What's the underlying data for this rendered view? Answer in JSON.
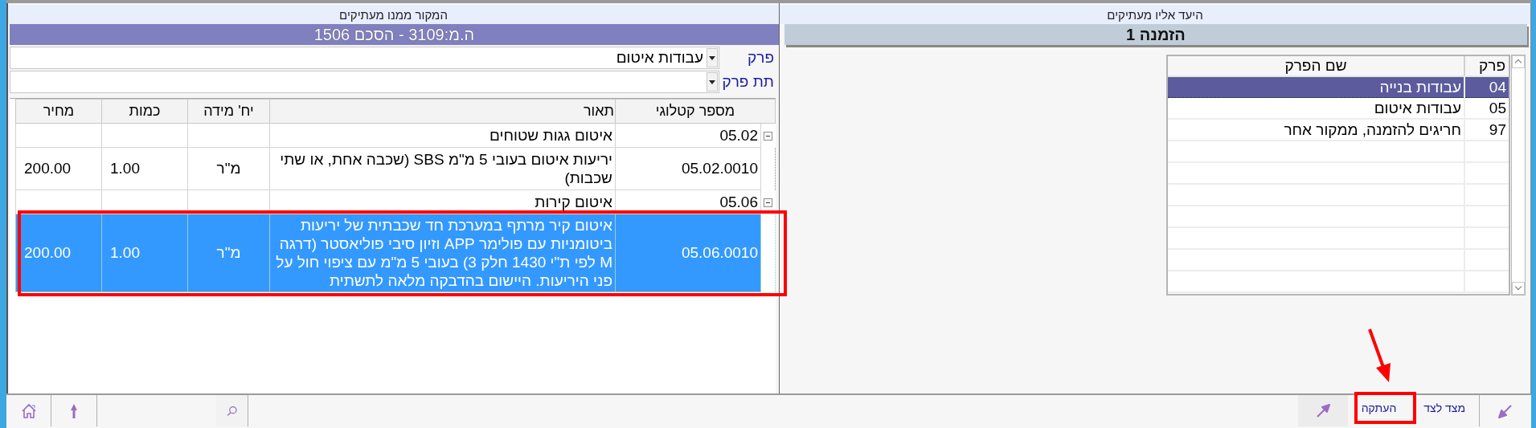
{
  "target_panel": {
    "caption": "היעד אליו מעתיקים",
    "title": "הזמנה 1",
    "list": {
      "columns": [
        "פרק",
        "שם הפרק"
      ],
      "rows": [
        {
          "number": "04",
          "name": "עבודות בנייה",
          "selected": true
        },
        {
          "number": "05",
          "name": "עבודות איטום",
          "selected": false
        },
        {
          "number": "97",
          "name": "חריגים להזמנה, ממקור אחר",
          "selected": false
        }
      ]
    }
  },
  "source_panel": {
    "caption": "המקור ממנו מעתיקים",
    "title": "ה.מ:3109 - הסכם 1506",
    "filters": [
      {
        "label": "פרק",
        "value": "עבודות איטום"
      },
      {
        "label": "תת פרק"
      }
    ],
    "table": {
      "columns": [
        "מספר קטלוגי",
        "תאור",
        "יח' מידה",
        "כמות",
        "מחיר"
      ],
      "rows": [
        {
          "kind": "group",
          "catalog": "05.02",
          "description": "איטום גגות שטוחים",
          "expanded": true,
          "children": [
            {
              "kind": "item",
              "catalog": "05.02.0010",
              "description": "יריעות איטום בעובי 5 מ\"מ SBS (שכבה אחת, או שתי שכבות)",
              "unit": "מ\"ר",
              "quantity": "1.00",
              "price": "200.00",
              "selected": false
            }
          ]
        },
        {
          "kind": "group",
          "catalog": "05.06",
          "description": "איטום קירות",
          "expanded": true,
          "children": [
            {
              "kind": "item",
              "catalog": "05.06.0010",
              "description": "איטום קיר מרתף במערכת חד שכבתית של יריעות ביטומניות עם פולימר APP וזיון סיבי פוליאסטר (דרגה M לפי ת\"י 1430 חלק 3) בעובי 5 מ\"מ עם ציפוי חול על פני היריעות. היישום בהדבקה מלאה לתשתית",
              "unit": "מ\"ר",
              "quantity": "1.00",
              "price": "200.00",
              "selected": true
            }
          ]
        }
      ]
    }
  },
  "toolbar": {
    "buttons": [
      {
        "label": "מצד לצד"
      },
      {
        "label": "העתקה"
      }
    ]
  }
}
